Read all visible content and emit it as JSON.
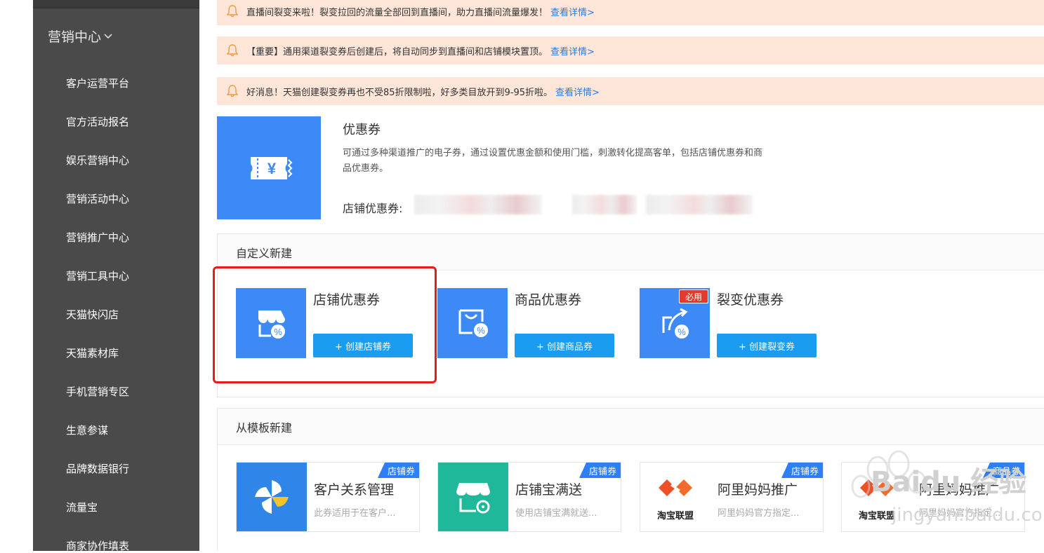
{
  "sidebar": {
    "title": "营销中心",
    "items": [
      {
        "label": "客户运营平台"
      },
      {
        "label": "官方活动报名"
      },
      {
        "label": "娱乐营销中心"
      },
      {
        "label": "营销活动中心"
      },
      {
        "label": "营销推广中心"
      },
      {
        "label": "营销工具中心"
      },
      {
        "label": "天猫快闪店"
      },
      {
        "label": "天猫素材库"
      },
      {
        "label": "手机营销专区"
      },
      {
        "label": "生意参谋"
      },
      {
        "label": "品牌数据银行"
      },
      {
        "label": "流量宝"
      },
      {
        "label": "商家协作填表"
      }
    ]
  },
  "notices": [
    {
      "text": "直播间裂变来啦！裂变拉回的流量全部回到直播间，助力直播间流量爆发！",
      "link": "查看详情>"
    },
    {
      "text": "【重要】通用渠道裂变券后创建后，将自动同步到直播间和店铺模块置顶。",
      "link": "查看详情>"
    },
    {
      "text": "好消息！天猫创建裂变券再也不受85折限制啦，好多类目放开到9-95折啦。",
      "link": "查看详情>"
    }
  ],
  "intro": {
    "title": "优惠券",
    "description": "可通过多种渠道推广的电子券，通过设置优惠金额和使用门槛，刺激转化提高客单，包括店铺优惠券和商品优惠券。",
    "store_label": "店铺优惠券:"
  },
  "custom_panel": {
    "heading": "自定义新建",
    "cards": [
      {
        "title": "店铺优惠券",
        "button": "+ 创建店铺券",
        "icon": "store-coupon-icon"
      },
      {
        "title": "商品优惠券",
        "button": "+ 创建商品券",
        "icon": "bag-coupon-icon"
      },
      {
        "title": "裂变优惠券",
        "button": "+ 创建裂变券",
        "icon": "share-coupon-icon",
        "badge": "必用"
      }
    ]
  },
  "template_panel": {
    "heading": "从模板新建",
    "cards": [
      {
        "title": "客户关系管理",
        "desc": "此券适用于在客户...",
        "tag": "店铺券",
        "icon_color": "#2f85e8"
      },
      {
        "title": "店铺宝满送",
        "desc": "使用店铺宝满就送...",
        "tag": "店铺券",
        "icon_color": "#1fb89a"
      },
      {
        "title": "阿里妈妈推广",
        "desc": "阿里妈妈官方指定...",
        "tag": "店铺券",
        "icon_label": "淘宝联盟"
      },
      {
        "title": "阿里妈妈推广",
        "desc": "阿里妈妈官方指定...",
        "tag": "商品券",
        "icon_label": "淘宝联盟"
      }
    ]
  },
  "watermark": {
    "brand": "Baidu 经验",
    "sub": "jingyan.baidu.com"
  },
  "colors": {
    "accent": "#3d8af7",
    "button": "#1a9cf0",
    "notice_bg": "#fde5d8",
    "highlight": "#e61c1c",
    "sidebar_bg": "#4a4a4a"
  }
}
